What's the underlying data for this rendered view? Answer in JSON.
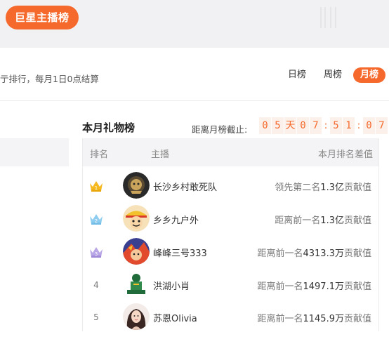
{
  "top": {
    "badge": "巨星主播榜"
  },
  "rule_text": "亍排行，每月1日0点结算",
  "tabs": [
    {
      "label": "日榜",
      "active": false
    },
    {
      "label": "周榜",
      "active": false
    },
    {
      "label": "月榜",
      "active": true
    }
  ],
  "panel": {
    "title": "本月礼物榜",
    "countdown_label": "距离月榜截止:",
    "countdown": {
      "days": [
        "0",
        "5"
      ],
      "day_unit": "天",
      "hours": [
        "0",
        "7"
      ],
      "minutes": [
        "5",
        "1"
      ],
      "seconds": [
        "0",
        "7"
      ],
      "sep": ":"
    }
  },
  "table": {
    "headers": {
      "rank": "排名",
      "host": "主播",
      "diff": "本月排名差值"
    },
    "rows": [
      {
        "rank": "1",
        "rank_style": "crown-gold",
        "name": "长沙乡村敢死队",
        "avatar": "avatar-dark-emblem",
        "diff_prefix": "领先第二名",
        "diff_value": "1.3亿",
        "diff_suffix": "贡献值"
      },
      {
        "rank": "2",
        "rank_style": "crown-blue",
        "name": "乡乡九户外",
        "avatar": "avatar-cartoon-pirate",
        "diff_prefix": "距离前一名",
        "diff_value": "1.3亿",
        "diff_suffix": "贡献值"
      },
      {
        "rank": "3",
        "rank_style": "crown-purple",
        "name": "峰峰三号333",
        "avatar": "avatar-colorful-anime",
        "diff_prefix": "距离前一名",
        "diff_value": "4313.3万",
        "diff_suffix": "贡献值"
      },
      {
        "rank": "4",
        "rank_style": "plain",
        "name": "洪湖小肖",
        "avatar": "avatar-green-team",
        "diff_prefix": "距离前一名",
        "diff_value": "1497.1万",
        "diff_suffix": "贡献值"
      },
      {
        "rank": "5",
        "rank_style": "plain",
        "name": "苏恩Olivia",
        "avatar": "avatar-woman-portrait",
        "diff_prefix": "距离前一名",
        "diff_value": "1145.9万",
        "diff_suffix": "贡献值"
      }
    ]
  },
  "colors": {
    "accent": "#f6692c",
    "crown_gold": "#f5b91e",
    "crown_blue": "#8fcdf0",
    "crown_purple": "#b9a6e6"
  }
}
